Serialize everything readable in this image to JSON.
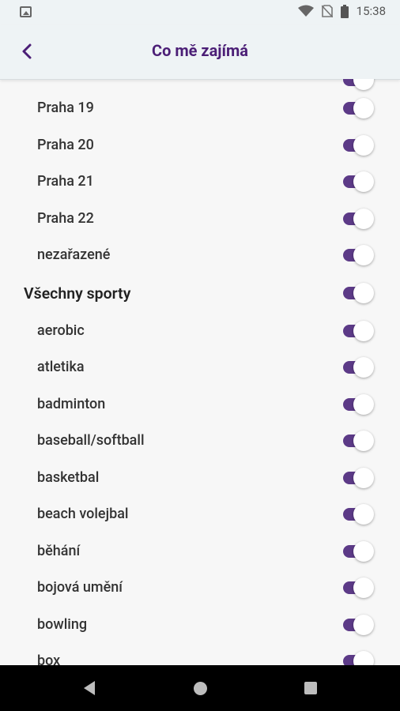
{
  "status_bar": {
    "time": "15:38",
    "icons": [
      "image-icon",
      "wifi-icon",
      "no-sim-icon",
      "battery-icon"
    ]
  },
  "app_bar": {
    "title": "Co mě zajímá",
    "back_icon": "chevron-left-icon"
  },
  "colors": {
    "title": "#4b1e76",
    "toggle_track": "#5c3a87",
    "toggle_knob": "#ffffff",
    "background": "#f7f7f7"
  },
  "list": {
    "items": [
      {
        "label": "",
        "on": true
      },
      {
        "label": "Praha 19",
        "on": true
      },
      {
        "label": "Praha 20",
        "on": true
      },
      {
        "label": "Praha 21",
        "on": true
      },
      {
        "label": "Praha 22",
        "on": true
      },
      {
        "label": "nezařazené",
        "on": true
      },
      {
        "label": "Všechny sporty",
        "on": true
      },
      {
        "label": "aerobic",
        "on": true
      },
      {
        "label": "atletika",
        "on": true
      },
      {
        "label": "badminton",
        "on": true
      },
      {
        "label": "baseball/softball",
        "on": true
      },
      {
        "label": "basketbal",
        "on": true
      },
      {
        "label": "beach volejbal",
        "on": true
      },
      {
        "label": "běhání",
        "on": true
      },
      {
        "label": "bojová umění",
        "on": true
      },
      {
        "label": "bowling",
        "on": true
      },
      {
        "label": "box",
        "on": true
      }
    ]
  },
  "nav_bar": {
    "icons": [
      "nav-back-icon",
      "nav-home-icon",
      "nav-recents-icon"
    ]
  }
}
